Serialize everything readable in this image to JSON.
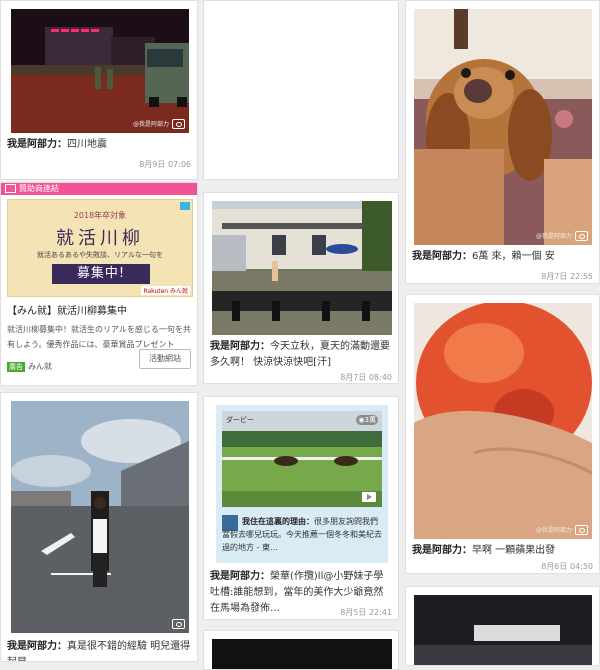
{
  "cards": [
    {
      "id": "c1",
      "caption_prefix": "我是阿部力：",
      "caption_text": "四川地震",
      "timestamp": "8月9日 07:06"
    },
    {
      "id": "c2",
      "caption_prefix": "",
      "caption_text": "",
      "timestamp": ""
    },
    {
      "id": "c3",
      "caption_prefix": "我是阿部力：",
      "caption_text": "6萬 來，賴一個 安",
      "timestamp": "8月7日 22:55",
      "watermark": "@我是阿部力"
    },
    {
      "id": "c4",
      "caption_prefix": "我是阿部力：",
      "caption_text": "今天立秋，夏天的滿動還要多久啊！ 快涼快涼快吧[汗]",
      "timestamp": "8月7日 08:40"
    },
    {
      "id": "c5",
      "caption_prefix": "我是阿部力：",
      "caption_text": "早啊 一顆蘋果出發",
      "timestamp": "8月6日 04:50",
      "watermark": "@我是阿部力"
    },
    {
      "id": "c6",
      "caption_prefix": "我是阿部力：",
      "caption_text": "真是很不錯的經驗 明兒還得起早，",
      "timestamp": ""
    },
    {
      "id": "c7",
      "caption_prefix": "我是阿部力：",
      "caption_text": "榮華(作攬)ll@小野妹子學吐槽:誰能想到，當年的美作大少爺竟然在馬場為發佈…",
      "timestamp": "8月5日 22:41"
    }
  ],
  "sponsor": {
    "bar_label": "贊助商連結",
    "banner_small": "2018年卒対象",
    "banner_big": "就活川柳",
    "banner_sub": "就活あるあるや失敗談、リアルな一句を",
    "banner_cta": "募集中!",
    "banner_brand": "Rakuten みん就",
    "title": "【みん就】就活川柳募集中",
    "description": "就活川柳募集中！就活生のリアルを感じる一句を共有しよう。優秀作品には、豪華賞品プレゼント",
    "foot_tag": "廣告",
    "foot_source": "みん就",
    "cta_button": "活動網站"
  },
  "embed": {
    "post_prefix": "我住在這裏的理由：",
    "post_text": "很多朋友詢問我們當假去哪兒玩玩。今天推薦一個冬冬和美紀去過的地方 - 東…",
    "views": "3萬",
    "image_title": "ダービー"
  }
}
